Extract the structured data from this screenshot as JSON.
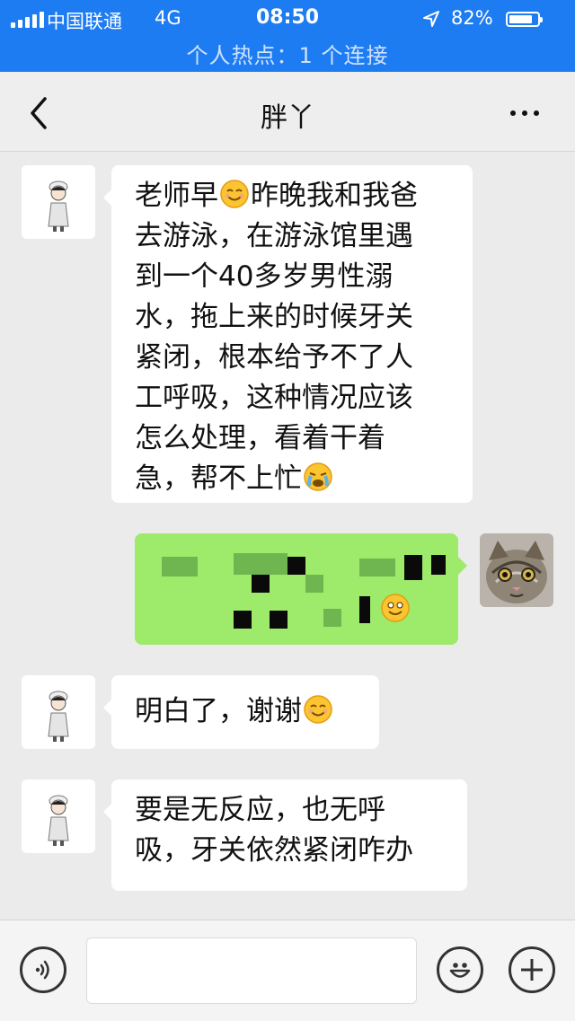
{
  "status_bar": {
    "carrier": "中国联通",
    "network": "4G",
    "time": "08:50",
    "battery_percent": "82%",
    "battery_level": 0.82,
    "hotspot": "个人热点：1 个连接",
    "bg_color": "#1e7cf2"
  },
  "nav": {
    "title": "胖丫",
    "back_icon": "chevron-left-icon",
    "more_icon": "ellipsis-icon"
  },
  "messages": [
    {
      "side": "left",
      "lines": [
        "老师早",
        "昨晚我和我爸",
        "去游泳，在游泳馆里遇",
        "到一个40多岁男性溺",
        "水，拖上来的时候牙关",
        "紧闭，根本给予不了人",
        "工呼吸，这种情况应该",
        "怎么处理，看着干着",
        "急，帮不上忙"
      ]
    },
    {
      "side": "right",
      "lines": [
        "[pixelated]"
      ]
    },
    {
      "side": "left",
      "lines": [
        "明白了，谢谢"
      ]
    },
    {
      "side": "left",
      "lines": [
        "要是无反应，也无呼",
        "吸，牙关依然紧闭咋办"
      ]
    }
  ],
  "input_bar": {
    "placeholder": "",
    "voice_icon": "voice-icon",
    "emoji_icon": "smiley-icon",
    "add_icon": "plus-icon"
  },
  "colors": {
    "sent_bubble": "#9eea6a",
    "received_bubble": "#ffffff",
    "chat_background": "#ebebeb"
  }
}
